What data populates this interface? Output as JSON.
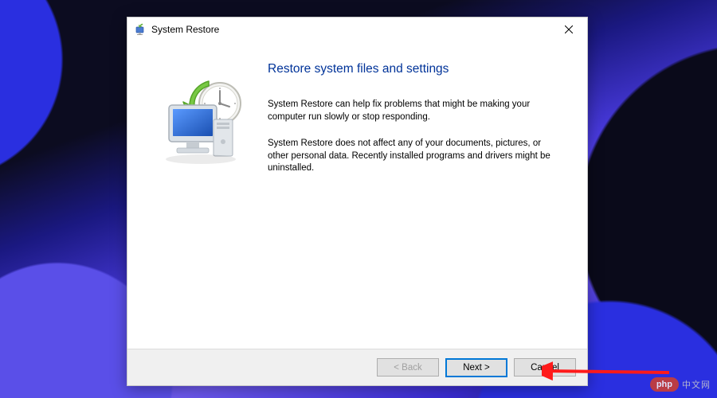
{
  "window": {
    "title": "System Restore"
  },
  "content": {
    "heading": "Restore system files and settings",
    "paragraph1": "System Restore can help fix problems that might be making your computer run slowly or stop responding.",
    "paragraph2": "System Restore does not affect any of your documents, pictures, or other personal data. Recently installed programs and drivers might be uninstalled."
  },
  "buttons": {
    "back": "< Back",
    "next": "Next >",
    "cancel": "Cancel"
  },
  "watermark": {
    "pill": "php",
    "text": "中文网"
  }
}
